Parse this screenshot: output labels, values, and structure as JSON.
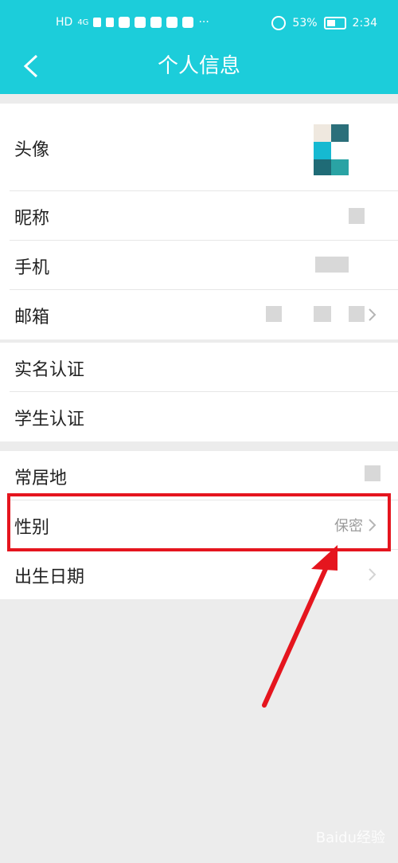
{
  "status_bar": {
    "left_text": "HD",
    "network": "4G",
    "battery": "53%",
    "time": "2:34",
    "more": "···"
  },
  "header": {
    "title": "个人信息",
    "back_icon": "chevron-left-icon"
  },
  "group1": {
    "avatar_label": "头像",
    "nickname_label": "昵称",
    "phone_label": "手机",
    "email_label": "邮箱"
  },
  "group2": {
    "realname_label": "实名认证",
    "student_label": "学生认证"
  },
  "group3": {
    "residence_label": "常居地",
    "gender_label": "性别",
    "gender_value": "保密",
    "birthday_label": "出生日期"
  },
  "watermark": "Baidu经验",
  "colors": {
    "header_bg": "#1ccdda",
    "annotation": "#e5151e"
  }
}
